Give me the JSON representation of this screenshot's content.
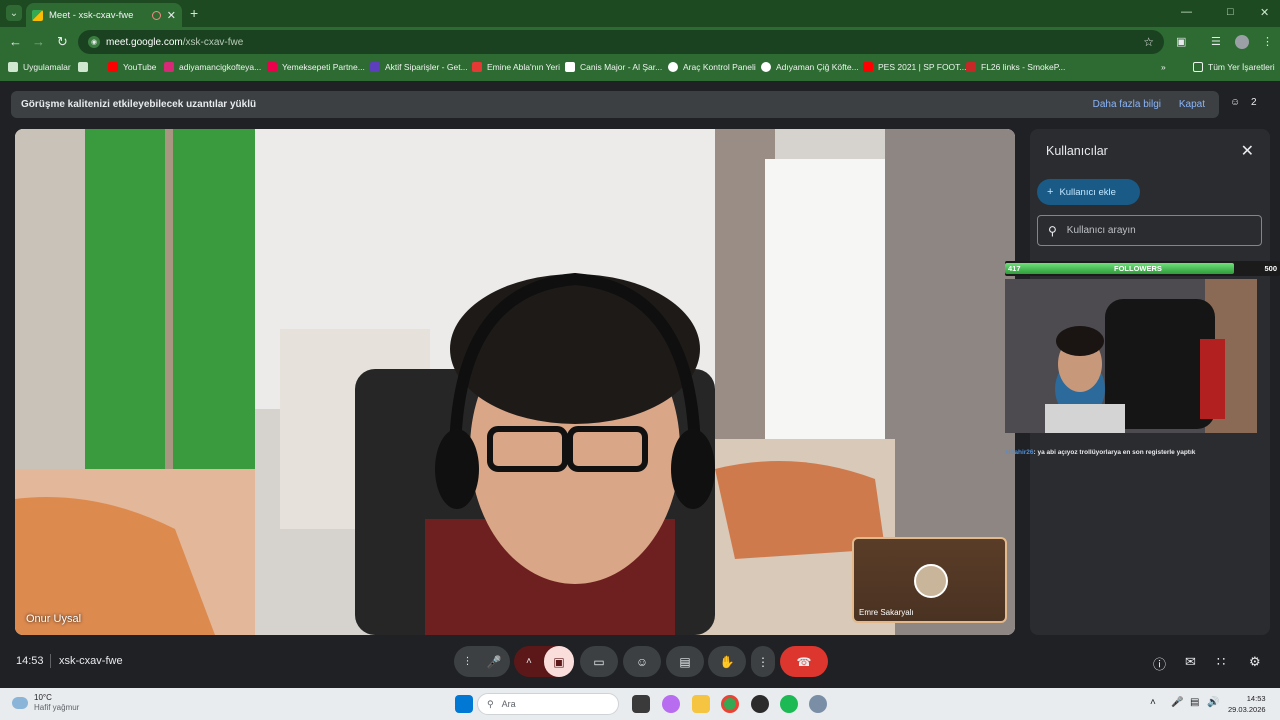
{
  "browser": {
    "tab_title": "Meet - xsk-cxav-fwe",
    "url_domain": "meet.google.com",
    "url_path": "/xsk-cxav-fwe",
    "bookmarks": [
      {
        "label": "Uygulamalar",
        "color": "#cfe8cf"
      },
      {
        "label": "YouTube",
        "color": "#ff0000"
      },
      {
        "label": "adiyamancigkofteya...",
        "color": "#d62976"
      },
      {
        "label": "Yemeksepeti Partne...",
        "color": "#ea004b"
      },
      {
        "label": "Aktif Siparişler - Get...",
        "color": "#5d3ebc"
      },
      {
        "label": "Emine Abla'nın Yeri",
        "color": "#e53935"
      },
      {
        "label": "Canis Major - Al Şar...",
        "color": "#ffffff"
      },
      {
        "label": "Araç Kontrol Paneli",
        "color": "#ffffff"
      },
      {
        "label": "Adıyaman Çiğ Köfte...",
        "color": "#ffffff"
      },
      {
        "label": "PES 2021 | SP FOOT...",
        "color": "#ff0000"
      },
      {
        "label": "FL26 links - SmokeP...",
        "color": "#c62828"
      }
    ],
    "all_bookmarks": "Tüm Yer İşaretleri"
  },
  "banner": {
    "text": "Görüşme kalitenizi etkileyebilecek uzantılar yüklü",
    "more": "Daha fazla bilgi",
    "close": "Kapat",
    "count": "2"
  },
  "main_video": {
    "name": "Onur Uysal"
  },
  "self_tile": {
    "name": "Emre Sakaryalı"
  },
  "panel": {
    "title": "Kullanıcılar",
    "add_user": "Kullanıcı ekle",
    "search_placeholder": "Kullanıcı arayın"
  },
  "overlay": {
    "followers_current": "417",
    "followers_label": "FOLLOWERS",
    "followers_goal": "500",
    "followers_progress": 0.834,
    "chat_user": "alltahir26",
    "chat_message": ": ya abi açıyoz trollüyorlarya en son registerle yaptık"
  },
  "bottom": {
    "time": "14:53",
    "meeting_code": "xsk-cxav-fwe"
  },
  "taskbar": {
    "temp": "10°C",
    "weather": "Hafif yağmur",
    "search": "Ara",
    "clock_time": "14:53",
    "clock_date": "29.03.2026"
  }
}
